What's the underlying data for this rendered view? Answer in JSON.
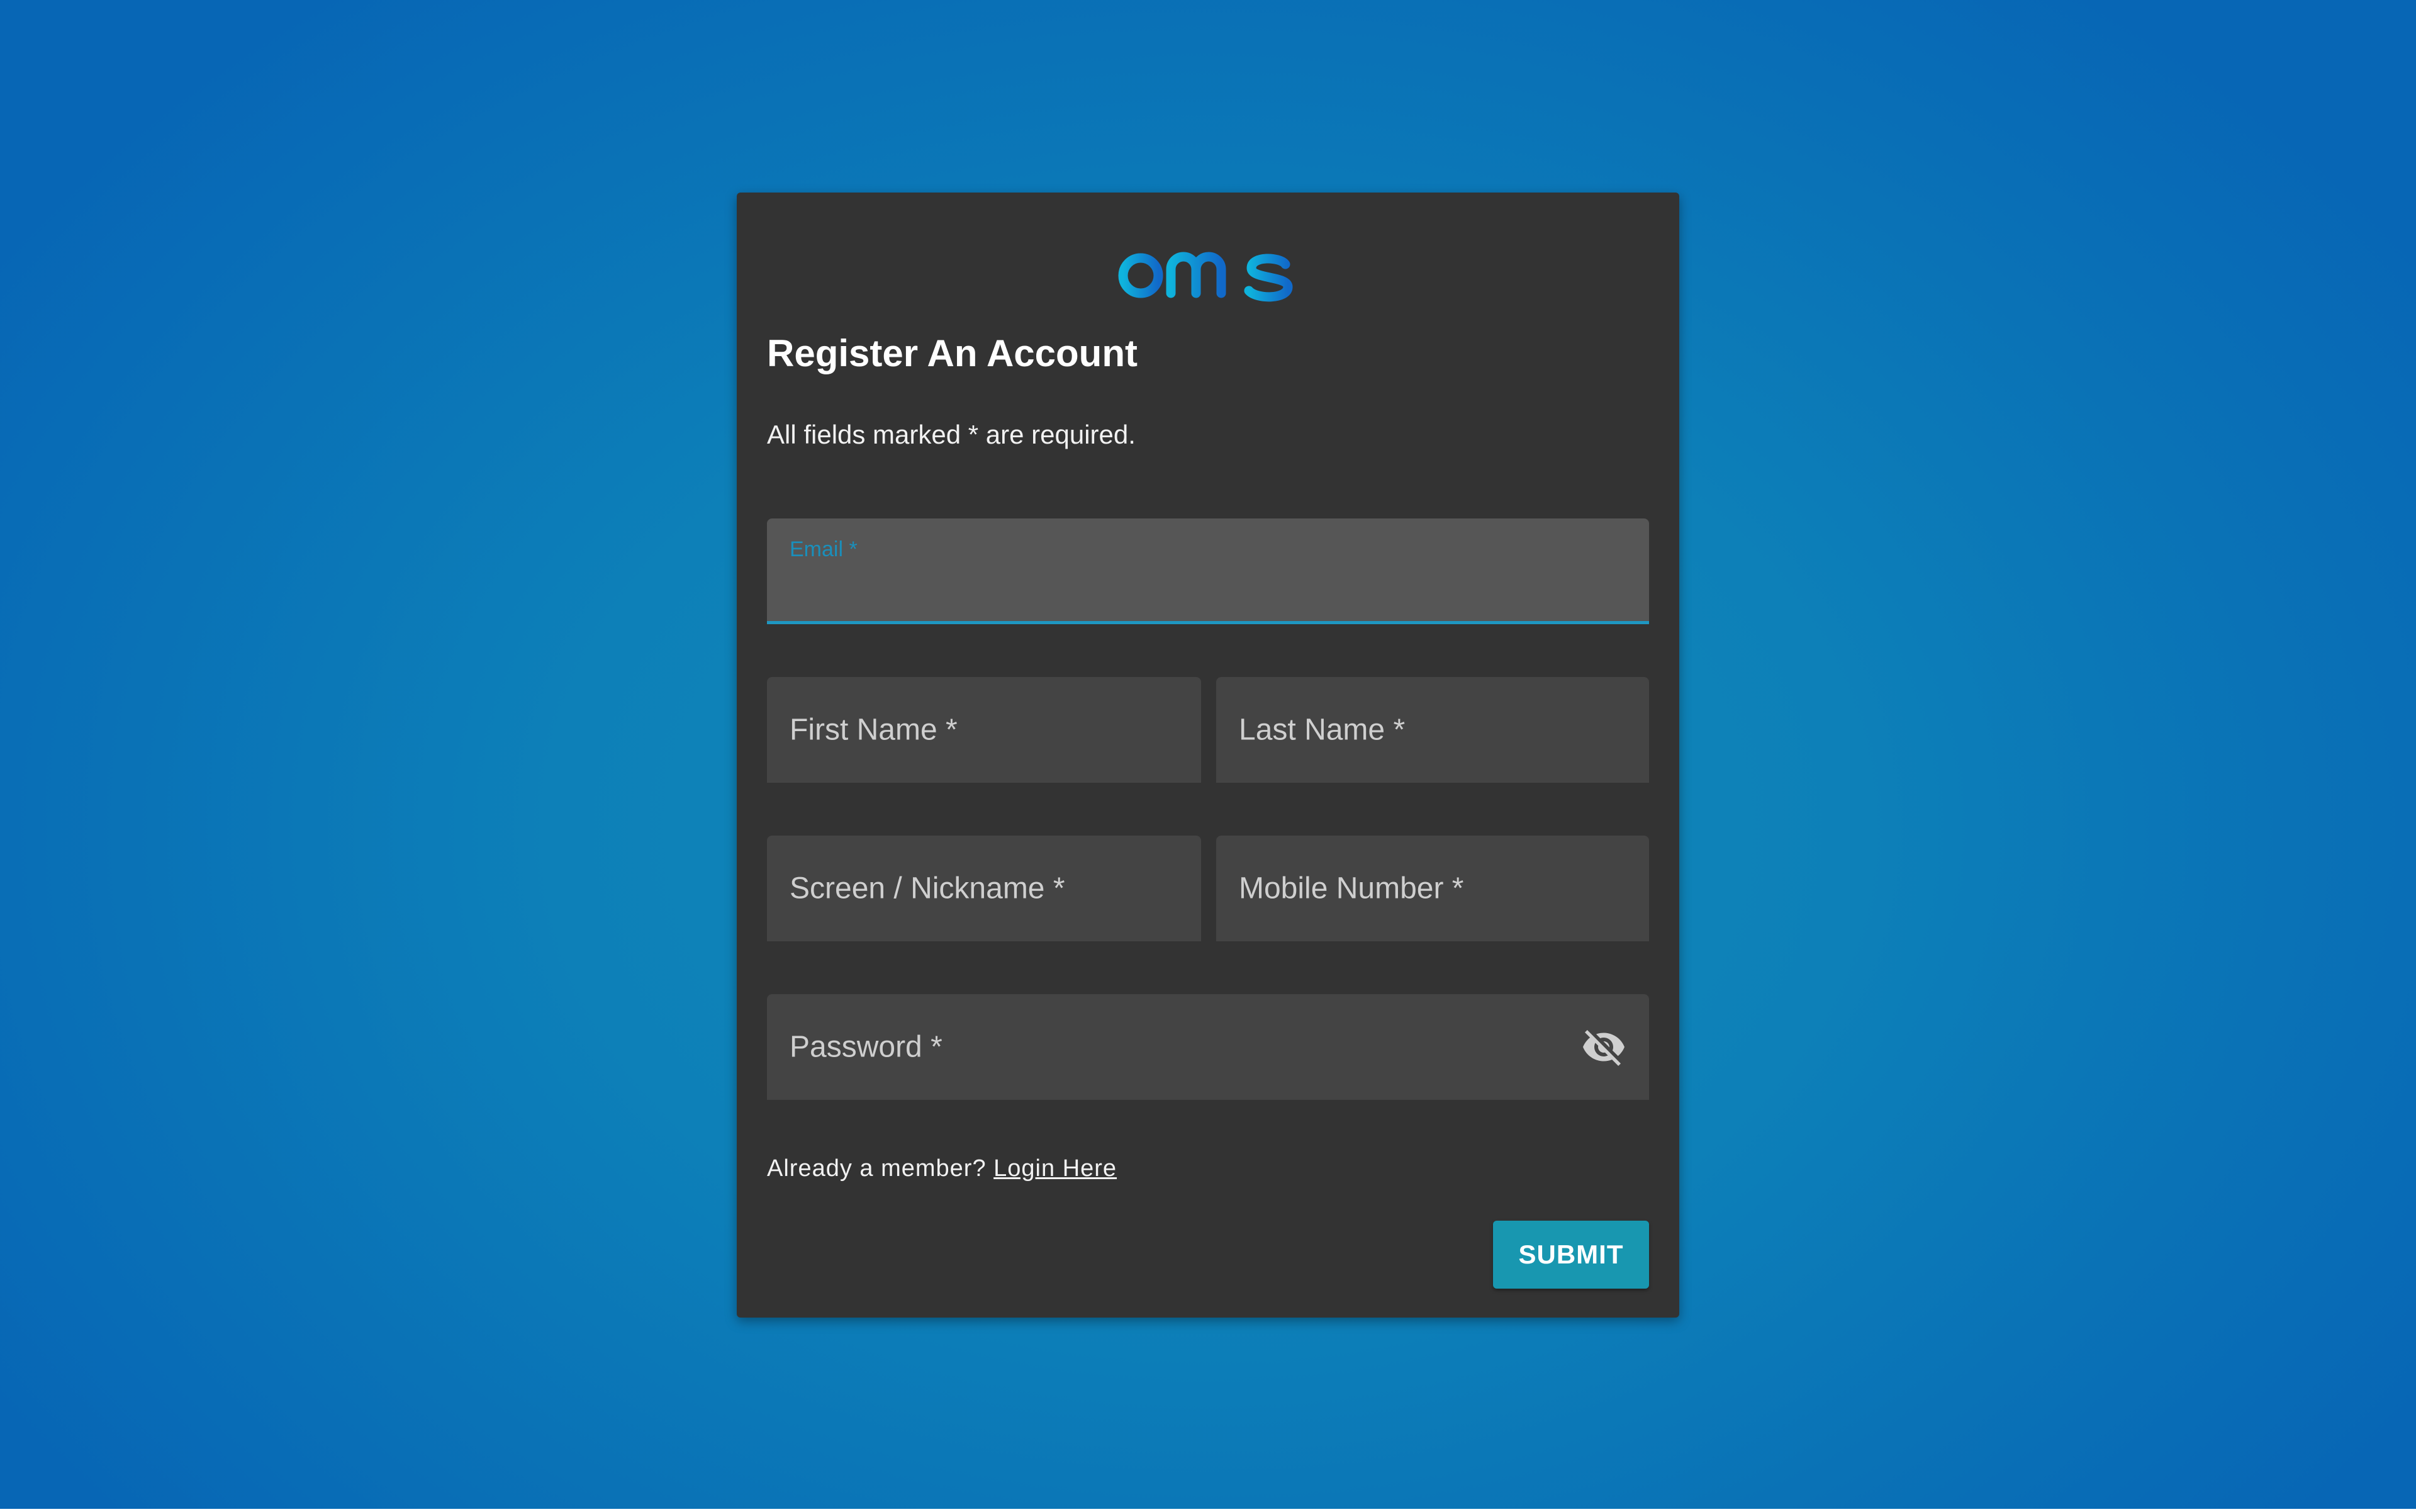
{
  "brand": {
    "logo_text": "bms",
    "colors": {
      "logo_start": "#0fb3dc",
      "logo_end": "#1169c9",
      "accent": "#1f97c2",
      "submit_bg": "#1897b0",
      "card_bg": "#333333"
    }
  },
  "form": {
    "title": "Register An Account",
    "required_note": "All fields marked * are required.",
    "fields": {
      "email": {
        "label": "Email *",
        "value": ""
      },
      "first_name": {
        "label": "First Name *",
        "value": ""
      },
      "last_name": {
        "label": "Last Name *",
        "value": ""
      },
      "nickname": {
        "label": "Screen / Nickname *",
        "value": ""
      },
      "mobile": {
        "label": "Mobile Number *",
        "value": ""
      },
      "password": {
        "label": "Password *",
        "value": "",
        "toggle_icon": "eye-off-icon"
      }
    },
    "member_prompt": "Already a member?",
    "login_link": "Login Here",
    "submit_label": "SUBMIT"
  }
}
